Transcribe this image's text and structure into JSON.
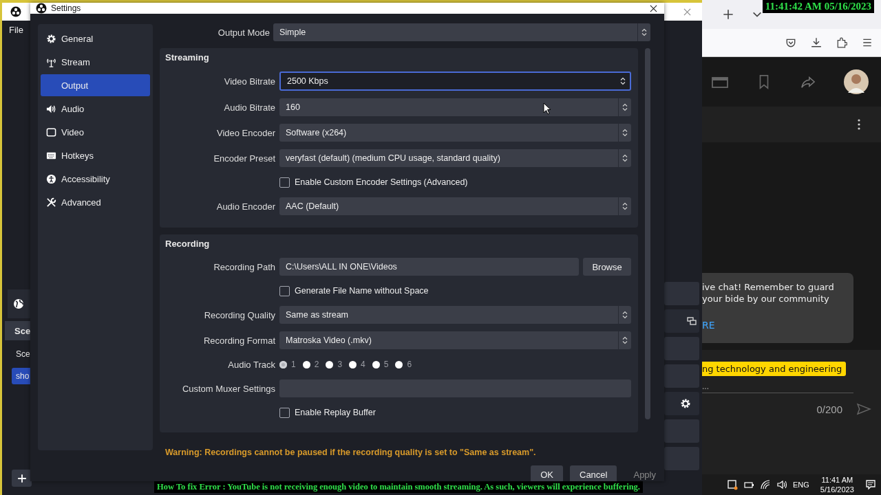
{
  "obs_window": {
    "menu": [
      "File"
    ],
    "scenes_header": "Sce",
    "scenes": [
      {
        "label": "Sce",
        "selected": false
      },
      {
        "label": "sho",
        "selected": true
      }
    ]
  },
  "settings": {
    "title": "Settings",
    "nav": [
      {
        "label": "General",
        "selected": false
      },
      {
        "label": "Stream",
        "selected": false
      },
      {
        "label": "Output",
        "selected": true
      },
      {
        "label": "Audio",
        "selected": false
      },
      {
        "label": "Video",
        "selected": false
      },
      {
        "label": "Hotkeys",
        "selected": false
      },
      {
        "label": "Accessibility",
        "selected": false
      },
      {
        "label": "Advanced",
        "selected": false
      }
    ],
    "output_mode": {
      "label": "Output Mode",
      "value": "Simple"
    },
    "sections": [
      {
        "title": "Streaming",
        "rows": [
          {
            "kind": "spin",
            "label": "Video Bitrate",
            "value": "2500 Kbps",
            "focused": true
          },
          {
            "kind": "select",
            "label": "Audio Bitrate",
            "value": "160"
          },
          {
            "kind": "select",
            "label": "Video Encoder",
            "value": "Software (x264)"
          },
          {
            "kind": "select",
            "label": "Encoder Preset",
            "value": "veryfast (default) (medium CPU usage, standard quality)"
          },
          {
            "kind": "checkbox",
            "label": "Enable Custom Encoder Settings (Advanced)",
            "checked": false
          },
          {
            "kind": "select",
            "label": "Audio Encoder",
            "value": "AAC (Default)"
          }
        ]
      },
      {
        "title": "Recording",
        "rows": [
          {
            "kind": "path",
            "label": "Recording Path",
            "value": "C:\\Users\\ALL IN ONE\\Videos",
            "button": "Browse"
          },
          {
            "kind": "checkbox",
            "label": "Generate File Name without Space",
            "checked": false
          },
          {
            "kind": "select",
            "label": "Recording Quality",
            "value": "Same as stream"
          },
          {
            "kind": "select",
            "label": "Recording Format",
            "value": "Matroska Video (.mkv)"
          },
          {
            "kind": "tracks",
            "label": "Audio Track",
            "tracks": [
              {
                "label": "1",
                "selected": true
              },
              {
                "label": "2",
                "selected": false
              },
              {
                "label": "3",
                "selected": false
              },
              {
                "label": "4",
                "selected": false
              },
              {
                "label": "5",
                "selected": false
              },
              {
                "label": "6",
                "selected": false
              }
            ]
          },
          {
            "kind": "text",
            "label": "Custom Muxer Settings"
          },
          {
            "kind": "checkbox",
            "label": "Enable Replay Buffer",
            "checked": false
          }
        ]
      }
    ],
    "warning": "Warning: Recordings cannot be paused if the recording quality is set to \"Same as stream\".",
    "buttons": [
      {
        "label": "OK",
        "disabled": false
      },
      {
        "label": "Cancel",
        "disabled": false
      },
      {
        "label": "Apply",
        "disabled": true
      }
    ]
  },
  "browser": {
    "chat_message": "ive chat! Remember to guard your bide by our community",
    "chat_link": "RE",
    "banner": "ng technology and engineering",
    "ellipsis": "...",
    "char_count": "0/200"
  },
  "taskbar": {
    "language": "ENG",
    "time": "11:41 AM",
    "date": "5/16/2023"
  },
  "overlay": {
    "timestamp": "11:41:42 AM 05/16/2023",
    "caption": "How To fix Error : YouTube is not receiving enough video to maintain smooth streaming. As such, viewers will experience buffering."
  }
}
